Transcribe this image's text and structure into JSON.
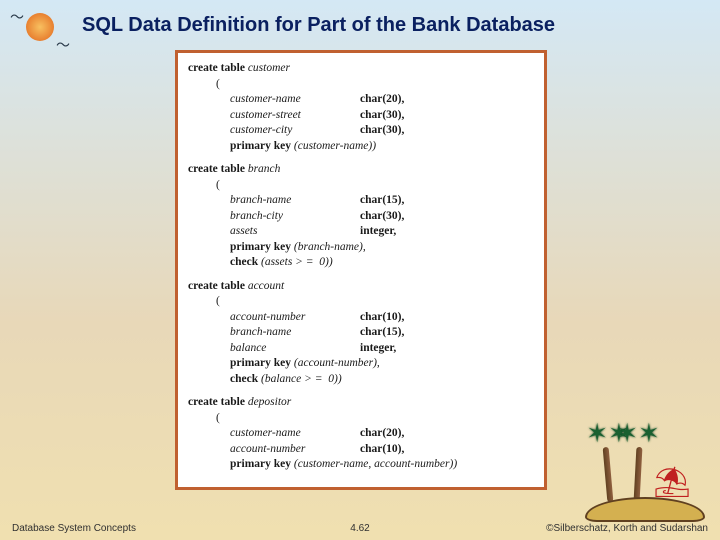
{
  "title": "SQL Data Definition for Part of the Bank Database",
  "tables": [
    {
      "head_kw": "create table ",
      "head_name": "customer",
      "lines": [
        {
          "t": "open",
          "txt": "("
        },
        {
          "t": "field",
          "name": "customer-name",
          "type": "char(20),"
        },
        {
          "t": "field",
          "name": "customer-street",
          "type": "char(30),"
        },
        {
          "t": "field",
          "name": "customer-city",
          "type": "char(30),"
        },
        {
          "t": "pk",
          "kw": "primary key ",
          "arg": "(customer-name))"
        }
      ]
    },
    {
      "head_kw": "create table ",
      "head_name": "branch",
      "lines": [
        {
          "t": "open",
          "txt": "("
        },
        {
          "t": "field",
          "name": "branch-name",
          "type": "char(15),"
        },
        {
          "t": "field",
          "name": "branch-city",
          "type": "char(30),"
        },
        {
          "t": "field",
          "name": "assets",
          "type": "integer,"
        },
        {
          "t": "pk",
          "kw": "primary key ",
          "arg": "(branch-name),"
        },
        {
          "t": "ck",
          "kw": "check ",
          "arg": "(assets > =  0))"
        }
      ]
    },
    {
      "head_kw": "create table ",
      "head_name": "account",
      "lines": [
        {
          "t": "open",
          "txt": "("
        },
        {
          "t": "field",
          "name": "account-number",
          "type": "char(10),"
        },
        {
          "t": "field",
          "name": "branch-name",
          "type": "char(15),"
        },
        {
          "t": "field",
          "name": "balance",
          "type": "integer,"
        },
        {
          "t": "pk",
          "kw": "primary key ",
          "arg": "(account-number),"
        },
        {
          "t": "ck",
          "kw": "check ",
          "arg": "(balance > =  0))"
        }
      ]
    },
    {
      "head_kw": "create table ",
      "head_name": "depositor",
      "lines": [
        {
          "t": "open",
          "txt": "("
        },
        {
          "t": "field",
          "name": "customer-name",
          "type": "char(20),"
        },
        {
          "t": "field",
          "name": "account-number",
          "type": "char(10),"
        },
        {
          "t": "pk",
          "kw": "primary key ",
          "arg": "(customer-name, account-number))"
        }
      ]
    }
  ],
  "footer": {
    "left": "Database System Concepts",
    "mid": "4.62",
    "right": "©Silberschatz, Korth and Sudarshan"
  }
}
